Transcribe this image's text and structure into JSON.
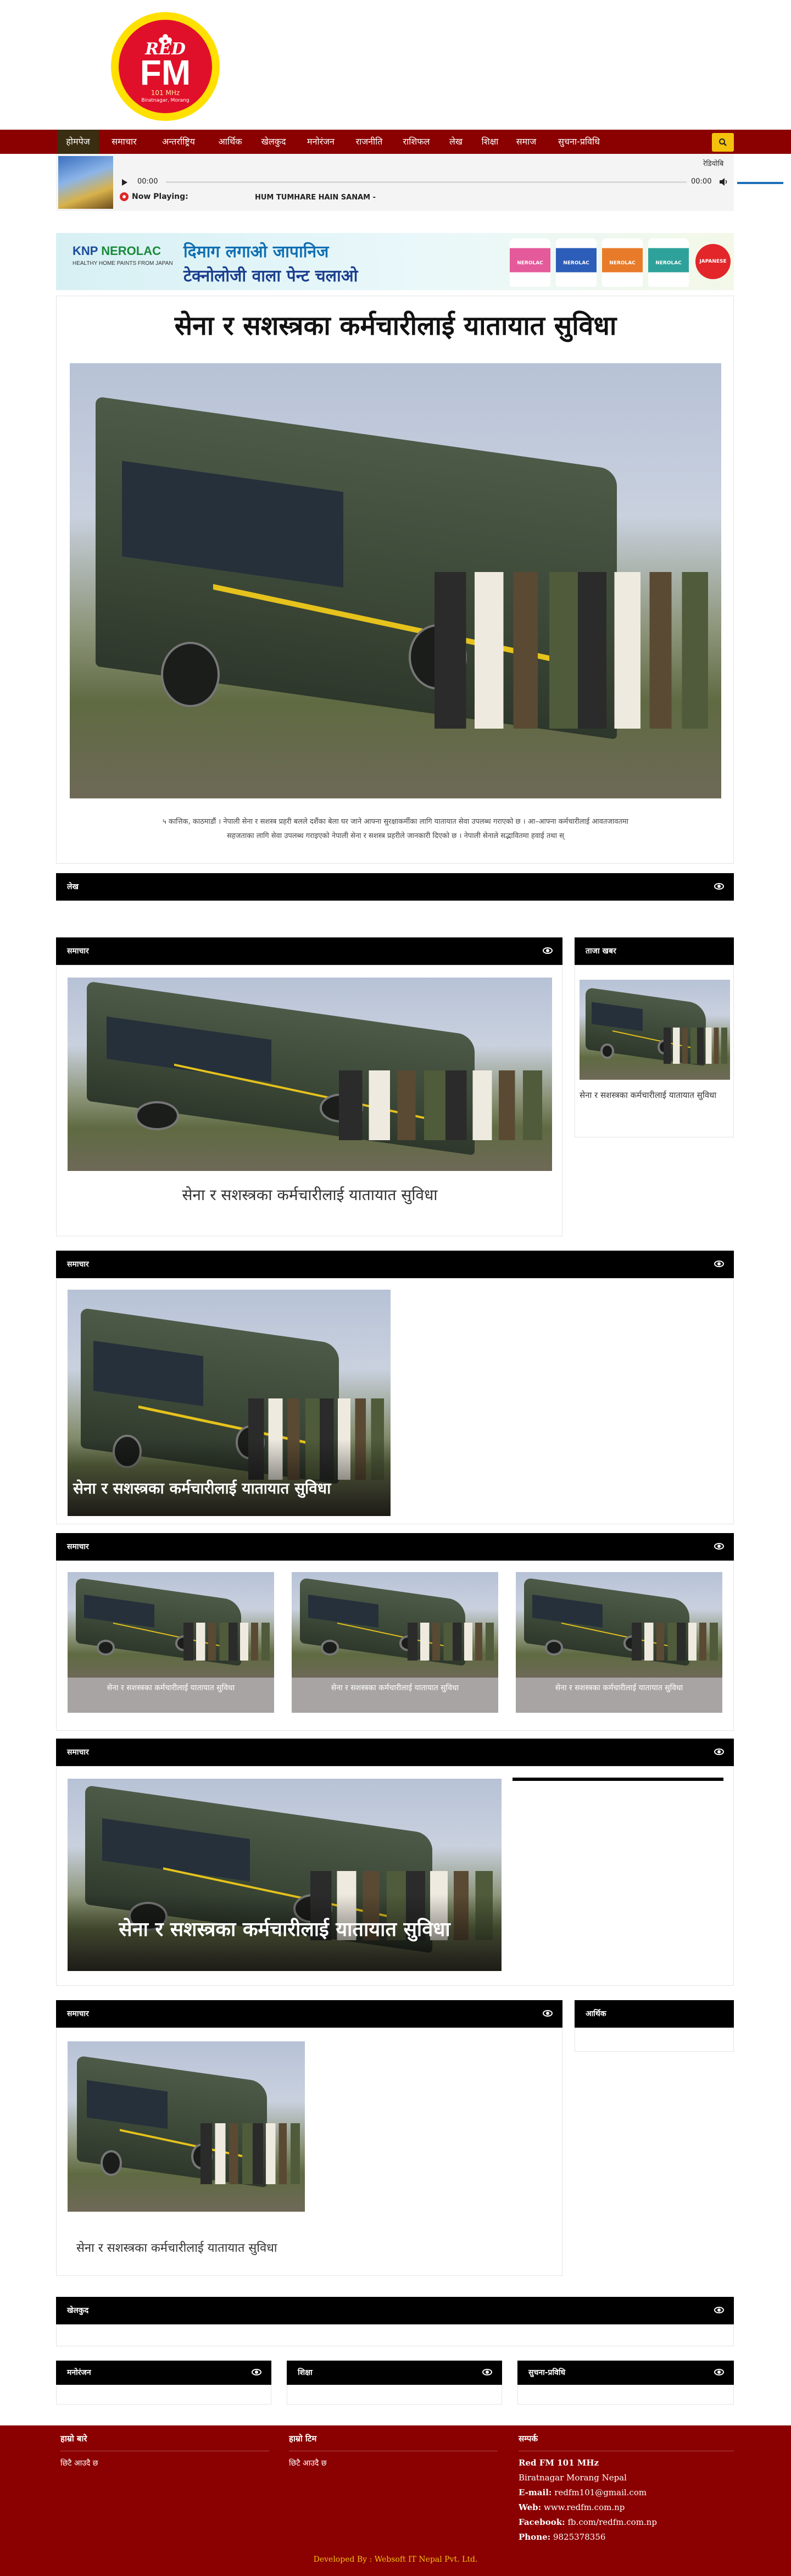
{
  "logo": {
    "text_red": "RED",
    "text_fm": "FM",
    "freq": "101 MHz",
    "tagline": "Biratnagar, Morang"
  },
  "nav": {
    "items": [
      "होमपेज",
      "समाचार",
      "अन्तर्राष्ट्रिय",
      "आर्थिक",
      "खेलकुद",
      "मनोरंजन",
      "राजनीति",
      "राशिफल",
      "लेख",
      "शिक्षा",
      "समाज",
      "सुचना-प्रविधि"
    ]
  },
  "player": {
    "label": "रेडियोबि",
    "time_start": "00:00",
    "time_end": "00:00",
    "now_playing_label": "Now Playing:",
    "now_playing": "HUM TUMHARE HAIN SANAM -",
    "progress": 0
  },
  "ad": {
    "brand_small": "KNP",
    "brand": "NEROLAC",
    "brand_sub": "HEALTHY HOME PAINTS FROM JAPAN",
    "line1": "दिमाग लगाओ जापानिज",
    "line2": "टेक्नोलोजी वाला पेन्ट चलाओ",
    "can_labels": [
      "NEROLAC",
      "NEROLAC",
      "NEROLAC",
      "NEROLAC"
    ],
    "badge": "JAPANESE"
  },
  "article": {
    "title": "सेना र सशस्त्रका कर्मचारीलाई यातायात सुविधा",
    "excerpt_1": "५ कात्तिक, काठमाडौं । नेपाली सेना र सशस्त्र प्रहरी बलले दशैंका बेला घर जाने आफ्ना सुरक्षाकर्मीका लागि यातायात सेवा उपलब्ध गराएको छ । आ–आफ्ना कर्मचारीलाई आवतजावतमा",
    "excerpt_2": "सहजताका लागि सेवा उपलब्ध गराइएको नेपाली सेना र सशस्त्र प्रहरीले जानकारी दिएको छ । नेपाली सेनाले सद्भावितमा हवाई तथा स्"
  },
  "sections": {
    "lekh": "लेख",
    "samachar": "समाचार",
    "taja": "ताजा खबर",
    "aarthik": "आर्थिक",
    "khelkud": "खेलकुद",
    "manoranjan": "मनोरंजन",
    "shiksha": "शिक्षा",
    "suchana": "सुचना-प्रविधि"
  },
  "news": {
    "headline": "सेना र सशस्त्रका कर्मचारीलाई यातायात सुविधा"
  },
  "footer": {
    "about_title": "हाम्रो बारे",
    "about_text": "छिटै आउदै छ",
    "team_title": "हाम्रो टिम",
    "team_text": "छिटै आउदै छ",
    "contact_title": "सम्पर्क",
    "station": "Red FM 101 MHz",
    "address": "Biratnagar Morang Nepal",
    "email_label": "E-mail:",
    "email": "redfm101@gmail.com",
    "web_label": "Web:",
    "web": "www.redfm.com.np",
    "facebook_label": "Facebook:",
    "facebook": "fb.com/redfm.com.np",
    "phone_label": "Phone:",
    "phone": "9825378356",
    "developed_by": "Developed By :",
    "developer": "Websoft IT Nepal Pvt. Ltd."
  },
  "colors": {
    "nav_bg": "#8b0000",
    "active_nav": "#3a2e12",
    "search": "#f4c20d",
    "panel_head": "#000000",
    "footer_bg": "#8b0000"
  }
}
